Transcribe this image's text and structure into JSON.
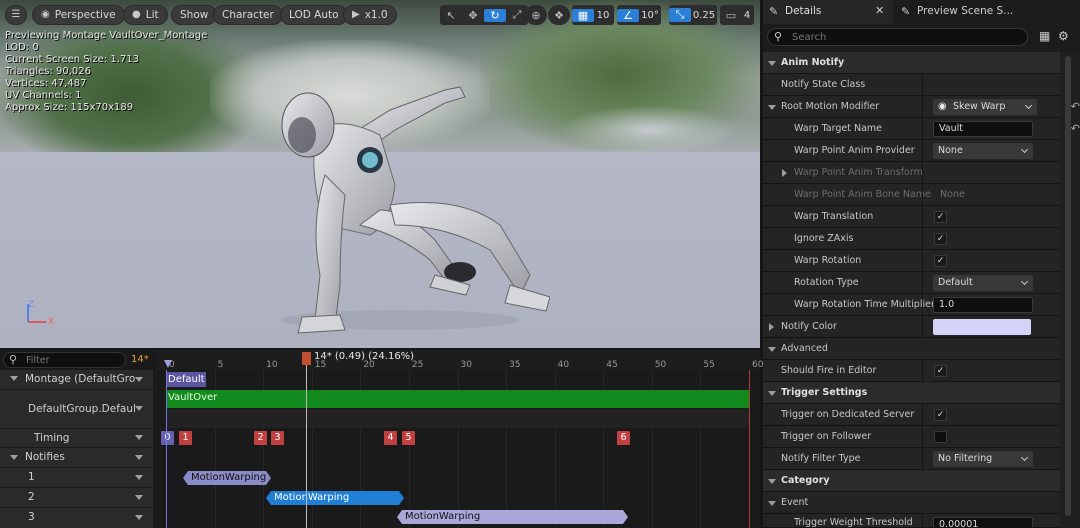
{
  "viewport_toolbar": {
    "perspective": "Perspective",
    "lit": "Lit",
    "show": "Show",
    "character": "Character",
    "lod": "LOD Auto",
    "speed": "x1.0",
    "grid_value": "10",
    "angle_value": "10°",
    "scale_value": "0.25",
    "camera_value": "4"
  },
  "stats": [
    "Previewing Montage VaultOver_Montage",
    "LOD: 0",
    "Current Screen Size: 1.713",
    "Triangles: 90,026",
    "Vertices: 47,487",
    "UV Channels: 1",
    "Approx Size: 115x70x189"
  ],
  "axis": {
    "z": "Z",
    "x": "X"
  },
  "timeline": {
    "filter_placeholder": "Filter",
    "frame_count": "14*",
    "playhead_label": "14* (0.49) (24.16%)",
    "ticks": [
      "0",
      "5",
      "10",
      "15",
      "20",
      "25",
      "30",
      "35",
      "40",
      "45",
      "50",
      "55",
      "60"
    ],
    "tracks": {
      "montage": "Montage (DefaultGro",
      "group": "DefaultGroup.Defaul",
      "timing": "Timing",
      "notifies": "Notifies",
      "n1": "1",
      "n2": "2",
      "n3": "3"
    },
    "section_default": "Default",
    "slot_name": "VaultOver",
    "timing_markers": [
      "0",
      "1",
      "2",
      "3",
      "4",
      "5",
      "6"
    ],
    "notify_1": "MotionWarping",
    "notify_2": "MotionWarping",
    "notify_3": "MotionWarping"
  },
  "details": {
    "tab_details": "Details",
    "tab_preview": "Preview Scene S...",
    "search_placeholder": "Search",
    "cat_anim_notify": "Anim Notify",
    "notify_state_class": "Notify State Class",
    "root_motion_modifier": "Root Motion Modifier",
    "root_motion_value": "Skew Warp",
    "warp_target_name": "Warp Target Name",
    "warp_target_value": "Vault",
    "warp_point_provider": "Warp Point Anim Provider",
    "warp_point_provider_value": "None",
    "warp_point_transform": "Warp Point Anim Transform",
    "warp_point_bone": "Warp Point Anim Bone Name",
    "warp_point_bone_value": "None",
    "warp_translation": "Warp Translation",
    "ignore_zaxis": "Ignore ZAxis",
    "warp_rotation": "Warp Rotation",
    "rotation_type": "Rotation Type",
    "rotation_type_value": "Default",
    "warp_rotation_time": "Warp Rotation Time Multiplier",
    "warp_rotation_time_value": "1.0",
    "notify_color": "Notify Color",
    "notify_color_value": "#d5d3f8",
    "advanced": "Advanced",
    "should_fire": "Should Fire in Editor",
    "cat_trigger": "Trigger Settings",
    "trigger_dedicated": "Trigger on Dedicated Server",
    "trigger_follower": "Trigger on Follower",
    "notify_filter_type": "Notify Filter Type",
    "notify_filter_value": "No Filtering",
    "cat_category": "Category",
    "event": "Event",
    "trigger_weight": "Trigger Weight Threshold",
    "trigger_weight_value": "0.00001"
  }
}
